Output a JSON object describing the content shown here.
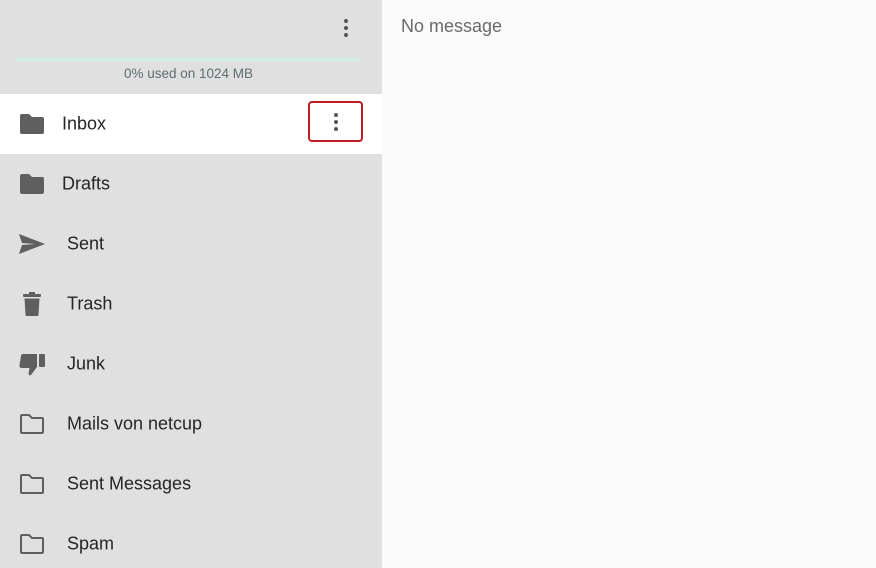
{
  "quota": {
    "text": "0% used on 1024 MB",
    "used_fraction": 0
  },
  "folders": [
    {
      "label": "Inbox",
      "icon": "folder-filled-icon",
      "active": true
    },
    {
      "label": "Drafts",
      "icon": "folder-filled-icon",
      "active": false
    },
    {
      "label": "Sent",
      "icon": "send-icon",
      "active": false
    },
    {
      "label": "Trash",
      "icon": "trash-icon",
      "active": false
    },
    {
      "label": "Junk",
      "icon": "thumbs-down-icon",
      "active": false
    },
    {
      "label": "Mails von netcup",
      "icon": "folder-outline-icon",
      "active": false
    },
    {
      "label": "Sent Messages",
      "icon": "folder-outline-icon",
      "active": false
    },
    {
      "label": "Spam",
      "icon": "folder-outline-icon",
      "active": false
    }
  ],
  "main": {
    "empty_text": "No message"
  },
  "colors": {
    "sidebar_bg": "#e0e0e0",
    "active_item_bg": "#ffffff",
    "highlight_border": "#c41a22",
    "icon": "#5f5f5f"
  }
}
